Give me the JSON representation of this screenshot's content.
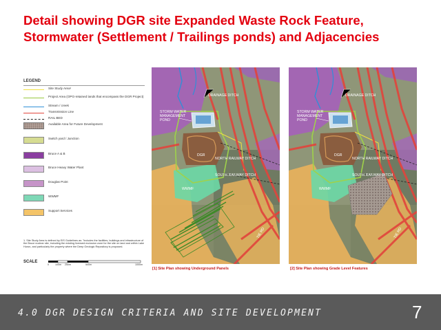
{
  "slide": {
    "title_line1": "Detail showing DGR site Expanded Waste Rock Feature,",
    "title_line2": "Stormwater (Settlement / Trailings ponds) and Adjacencies"
  },
  "legend": {
    "title": "LEGEND",
    "items": [
      {
        "label": "Site Study Area¹",
        "swatch": "#f0e040",
        "kind": "line"
      },
      {
        "label": "Project Area (OPG-retained lands that encompass the DGR Project)",
        "swatch": "#96c83c",
        "kind": "line"
      },
      {
        "label": "Stream / creek",
        "swatch": "#2f8fd8",
        "kind": "line"
      },
      {
        "label": "Transmission Line",
        "swatch": "#e2443c",
        "kind": "line"
      },
      {
        "label": "RAIL BED",
        "swatch": "#222222",
        "kind": "dash"
      },
      {
        "label": "Available Area for Future Development",
        "swatch": "#b8a8a0",
        "kind": "pattern"
      },
      {
        "label": "Switch yard / Junction",
        "swatch": "#d6dc92",
        "kind": "box"
      },
      {
        "label": "Bruce A & B",
        "swatch": "#8a3ea0",
        "kind": "box"
      },
      {
        "label": "Bruce Heavy Water Plant",
        "swatch": "#dcc0e2",
        "kind": "box"
      },
      {
        "label": "Douglas Point",
        "swatch": "#c694c8",
        "kind": "box"
      },
      {
        "label": "WWMF",
        "swatch": "#7ed8b6",
        "kind": "box"
      },
      {
        "label": "Support Services",
        "swatch": "#f4c468",
        "kind": "box"
      }
    ],
    "note": "1. Site Study Area is defined by EIS Guidelines as: \"includes the facilities, buildings and infrastructure of the Bruce nuclear site, including the existing licensed exclusion zone for the site on land and within Lake Huron, and particularly the property where the Deep Geologic Repository is proposed.",
    "scale_label": "SCALE",
    "scale_ticks": [
      "0",
      "100m",
      "250m",
      "500m",
      "1000m"
    ]
  },
  "maps": [
    {
      "caption": "[1]  Site Plan showing Underground Panels",
      "labels": {
        "drainage": "DRAINAGE DITCH",
        "storm1": "STORM WATER",
        "storm2": "MANAGEMENT",
        "storm3": "POND",
        "dgr": "DGR",
        "north": "NORTH RAILWAY DITCH",
        "south": "SOUTH RAILWAY DITCH",
        "wwmf": "WWMF",
        "tierd": "TIE RD"
      }
    },
    {
      "caption": "[2]  Site Plan showing Grade Level Features",
      "labels": {
        "drainage": "DRAINAGE DITCH",
        "storm1": "STORM WATER",
        "storm2": "MANAGEMENT",
        "storm3": "POND",
        "dgr": "DGR",
        "north": "NORTH RAILWAY DITCH",
        "south": "SOUTH RAILWAY DITCH",
        "wwmf": "WWMF",
        "tierd": "TIE RD"
      }
    }
  ],
  "footer": {
    "section": "4.0 DGR DESIGN CRITERIA AND SITE DEVELOPMENT",
    "page": "7"
  }
}
